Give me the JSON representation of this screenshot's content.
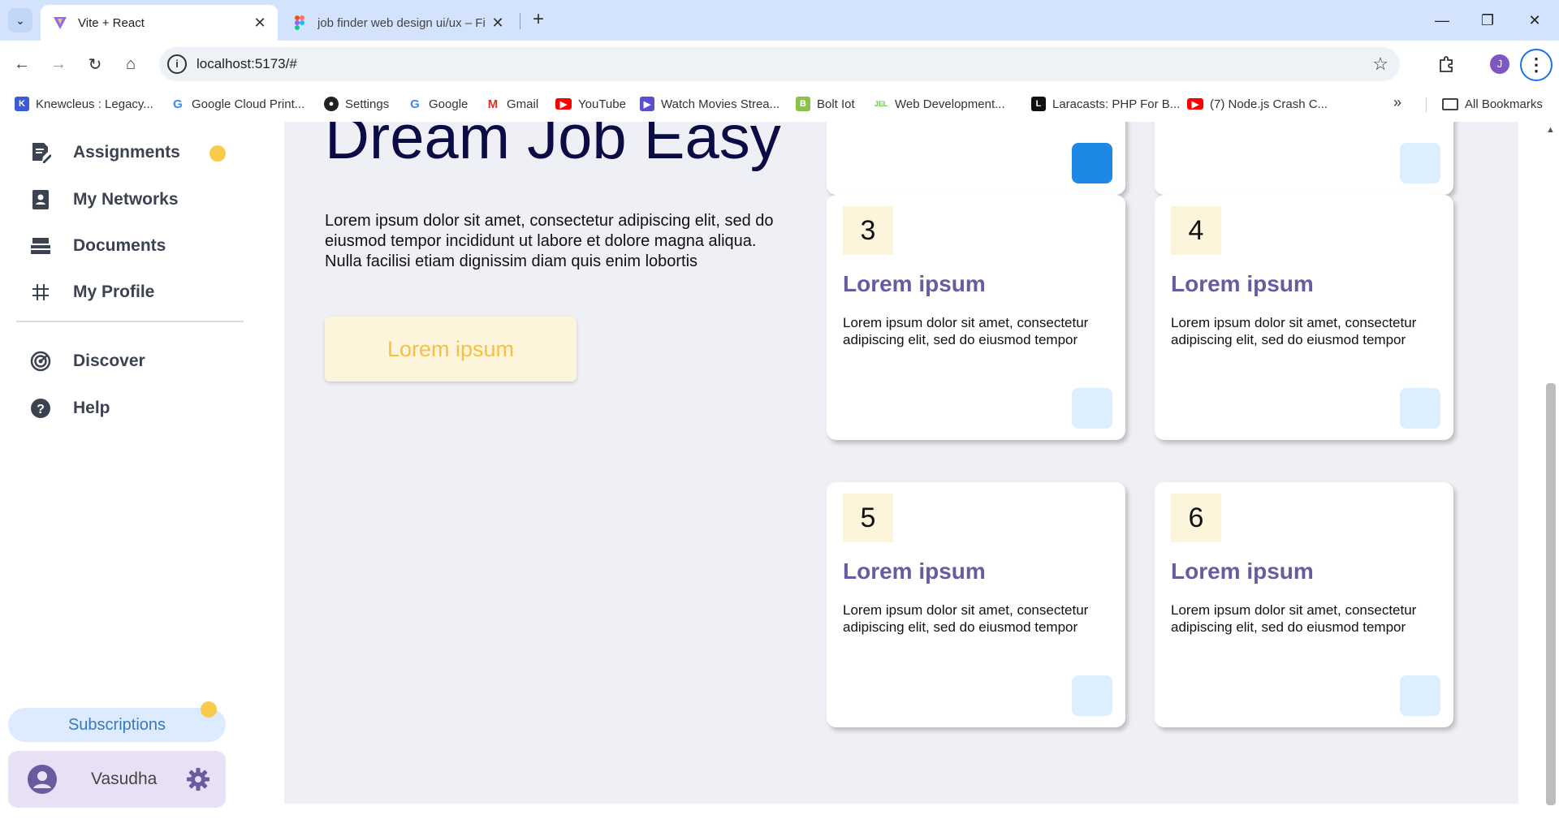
{
  "browser": {
    "tabs": [
      {
        "title": "Vite + React",
        "active": true
      },
      {
        "title": "job finder web design ui/ux – Fi",
        "active": false
      }
    ],
    "url": "localhost:5173/#",
    "profile_initial": "J",
    "bookmarks": [
      {
        "label": "Knewcleus : Legacy...",
        "icon": "knewcleus-icon"
      },
      {
        "label": "Google Cloud Print...",
        "icon": "google-icon"
      },
      {
        "label": "Settings",
        "icon": "github-icon"
      },
      {
        "label": "Google",
        "icon": "google-icon"
      },
      {
        "label": "Gmail",
        "icon": "gmail-icon"
      },
      {
        "label": "YouTube",
        "icon": "youtube-icon"
      },
      {
        "label": "Watch Movies Strea...",
        "icon": "play-icon"
      },
      {
        "label": "Bolt Iot",
        "icon": "bolt-icon"
      },
      {
        "label": "Web Development...",
        "icon": "web-dev-icon"
      },
      {
        "label": "Laracasts: PHP For B...",
        "icon": "laracasts-icon"
      },
      {
        "label": "(7) Node.js Crash C...",
        "icon": "youtube-icon"
      }
    ],
    "all_bookmarks": "All Bookmarks"
  },
  "sidebar": {
    "items": [
      {
        "label": "Assignments",
        "icon": "assignment-icon",
        "has_dot": true
      },
      {
        "label": "My Networks",
        "icon": "contacts-icon"
      },
      {
        "label": "Documents",
        "icon": "documents-icon"
      },
      {
        "label": "My Profile",
        "icon": "hash-icon"
      },
      {
        "label": "Discover",
        "icon": "radar-icon"
      },
      {
        "label": "Help",
        "icon": "help-icon"
      }
    ],
    "subscriptions": "Subscriptions",
    "user_name": "Vasudha"
  },
  "hero": {
    "title": "Dream Job Easy",
    "text": "Lorem ipsum dolor sit amet, consectetur adipiscing elit, sed do eiusmod tempor incididunt ut labore et dolore magna aliqua. Nulla facilisi etiam dignissim diam quis enim lobortis",
    "button": "Lorem ipsum"
  },
  "cards": [
    {
      "number": "3",
      "title": "Lorem ipsum",
      "text": "Lorem ipsum dolor sit amet, consectetur adipiscing elit, sed do eiusmod tempor"
    },
    {
      "number": "4",
      "title": "Lorem ipsum",
      "text": "Lorem ipsum dolor sit amet, consectetur adipiscing elit, sed do eiusmod tempor"
    },
    {
      "number": "5",
      "title": "Lorem ipsum",
      "text": "Lorem ipsum dolor sit amet, consectetur adipiscing elit, sed do eiusmod tempor"
    },
    {
      "number": "6",
      "title": "Lorem ipsum",
      "text": "Lorem ipsum dolor sit amet, consectetur adipiscing elit, sed do eiusmod tempor"
    }
  ],
  "colors": {
    "accent_yellow": "#f8cb4a",
    "card_title": "#6a5aa0",
    "hero_title": "#0b0b45",
    "subscriptions_bg": "#dcebff",
    "user_card_bg": "#e8e1f5"
  }
}
